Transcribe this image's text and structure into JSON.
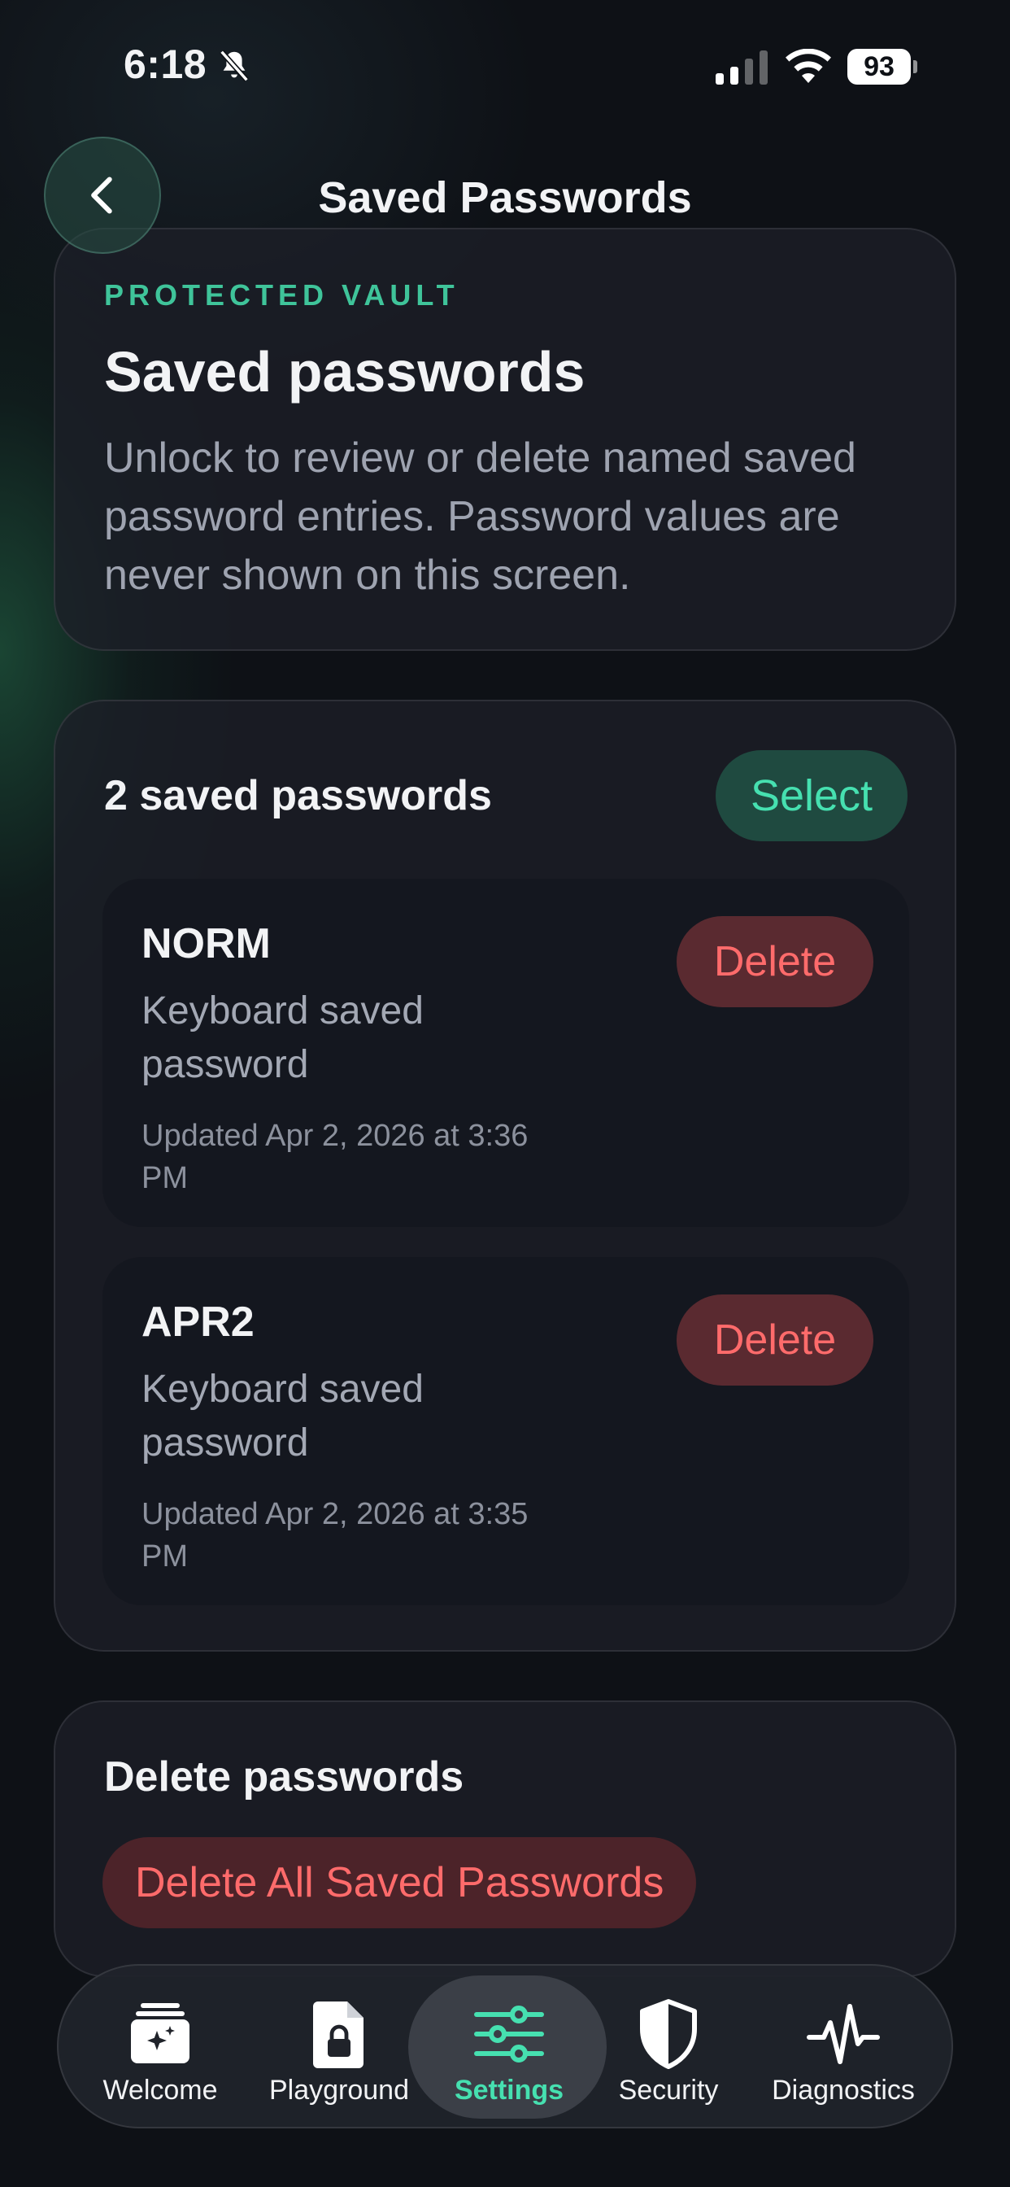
{
  "status_bar": {
    "time": "6:18",
    "battery": "93",
    "icons": [
      "bell-slash-icon",
      "signal-icon",
      "wifi-icon",
      "battery-icon"
    ]
  },
  "header": {
    "title": "Saved Passwords",
    "back_icon": "chevron-left-icon"
  },
  "intro": {
    "eyebrow": "PROTECTED VAULT",
    "title": "Saved passwords",
    "description": "Unlock to review or delete named saved password entries. Password values are never shown on this screen."
  },
  "list": {
    "count_label": "2 saved passwords",
    "select_label": "Select",
    "entries": [
      {
        "name": "NORM",
        "type": "Keyboard saved password",
        "updated": "Updated Apr 2, 2026 at 3:36 PM",
        "delete_label": "Delete"
      },
      {
        "name": "APR2",
        "type": "Keyboard saved password",
        "updated": "Updated Apr 2, 2026 at 3:35 PM",
        "delete_label": "Delete"
      }
    ]
  },
  "delete_section": {
    "title": "Delete passwords",
    "delete_all_label": "Delete All Saved Passwords"
  },
  "tab_bar": {
    "active": "Settings",
    "tabs": [
      {
        "label": "Welcome",
        "icon": "sparkle-card-icon"
      },
      {
        "label": "Playground",
        "icon": "locked-document-icon"
      },
      {
        "label": "Settings",
        "icon": "sliders-icon"
      },
      {
        "label": "Security",
        "icon": "shield-icon"
      },
      {
        "label": "Diagnostics",
        "icon": "waveform-icon"
      }
    ]
  },
  "colors": {
    "accent": "#46e0b0",
    "eyebrow": "#3fc49a",
    "danger": "#ff6b6b",
    "background": "#0e1116"
  }
}
